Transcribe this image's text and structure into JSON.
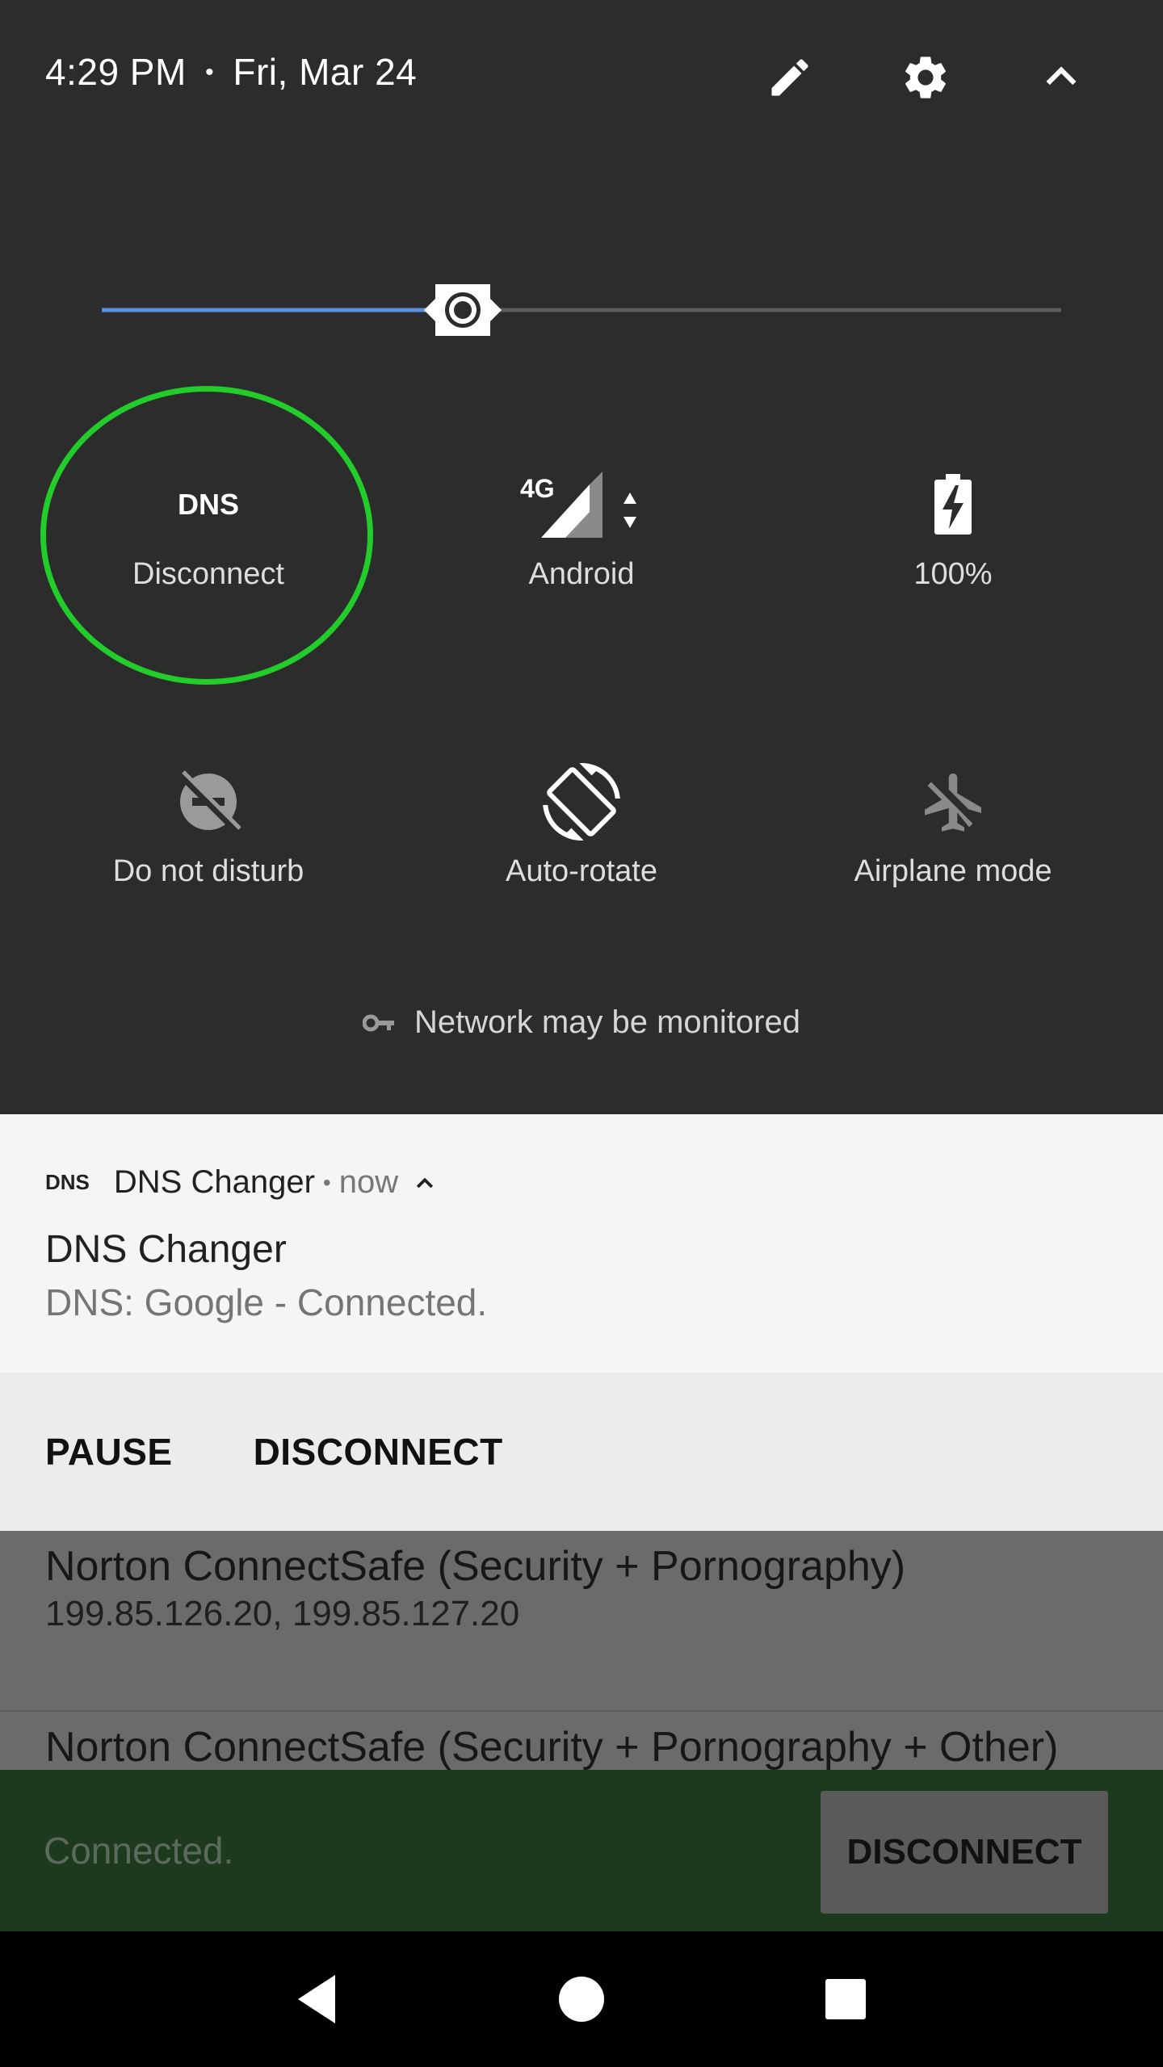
{
  "status": {
    "time": "4:29 PM",
    "separator": "•",
    "date": "Fri, Mar 24"
  },
  "header_icons": [
    "edit-pencil-icon",
    "settings-gear-icon",
    "collapse-chevron-up-icon"
  ],
  "brightness": {
    "level": 0.376,
    "accent": "#5a8edc"
  },
  "tiles": [
    {
      "id": "dns",
      "icon_text": "DNS",
      "label": "Disconnect"
    },
    {
      "id": "cellular",
      "icon_text": "4G",
      "label": "Android"
    },
    {
      "id": "battery",
      "label": "100%"
    },
    {
      "id": "dnd",
      "label": "Do not disturb"
    },
    {
      "id": "autorotate",
      "label": "Auto-rotate"
    },
    {
      "id": "airplane",
      "label": "Airplane mode"
    }
  ],
  "monitor_text": "Network may be monitored",
  "highlight_color": "#22cc2a",
  "notification": {
    "app_icon": "DNS",
    "app_name": "DNS Changer",
    "dot": "•",
    "time": "now",
    "title": "DNS Changer",
    "text": "DNS: Google - Connected.",
    "actions": [
      "PAUSE",
      "DISCONNECT"
    ]
  },
  "app_list": [
    {
      "name": "Norton ConnectSafe (Security + Pornography)",
      "ips": "199.85.126.20, 199.85.127.20"
    },
    {
      "name": "Norton ConnectSafe (Security + Pornography + Other)"
    }
  ],
  "snackbar": {
    "text": "Connected.",
    "button": "DISCONNECT"
  }
}
